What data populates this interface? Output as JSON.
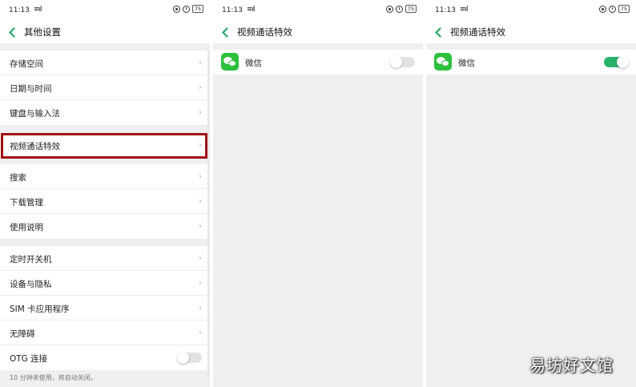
{
  "status": {
    "time": "11:13",
    "signal": "≡ıl",
    "battery": "75"
  },
  "screen1": {
    "title": "其他设置",
    "groups": [
      [
        "存储空间",
        "日期与时间",
        "键盘与输入法"
      ],
      [
        "视频通话特效"
      ],
      [
        "搜索",
        "下载管理",
        "使用说明"
      ],
      [
        "定时开关机",
        "设备与隐私",
        "SIM 卡应用程序",
        "无障碍"
      ]
    ],
    "otg_label": "OTG 连接",
    "otg_enabled": false,
    "footer_note": "10 分钟未使用，将自动关闭。",
    "chevron": "›"
  },
  "screen2": {
    "title": "视频通话特效",
    "app_label": "微信",
    "enabled": false
  },
  "screen3": {
    "title": "视频通话特效",
    "app_label": "微信",
    "enabled": true
  },
  "watermark": "易坊好文馆",
  "colors": {
    "accent": "#1aa55d",
    "toggle_on": "#28b36b",
    "highlight": "#a11212",
    "wechat": "#2dbf3d"
  }
}
